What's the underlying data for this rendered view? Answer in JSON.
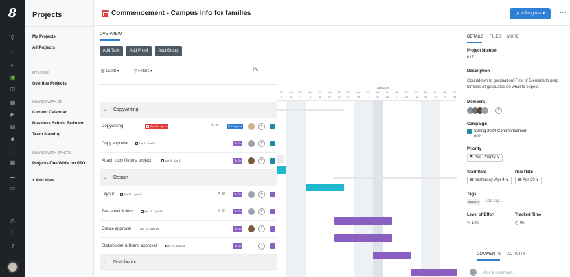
{
  "rail": {
    "logo": "8",
    "icons": [
      "search-icon",
      "home-icon",
      "megaphone-icon",
      "projects-icon",
      "approvals-icon",
      "print-icon",
      "tasks-icon",
      "calendar-icon",
      "people-icon",
      "user-icon",
      "grid-icon",
      "reports-icon",
      "file-icon",
      "clock-icon",
      "bell-icon",
      "help-icon"
    ]
  },
  "nav": {
    "title": "Projects",
    "my_projects": "My Projects",
    "all_projects": "All Projects",
    "my_views_label": "MY VIEWS",
    "overdue": "Overdue Projects",
    "shared_with_me_label": "SHARED WITH ME",
    "shared_with_me": [
      "Content Calendar",
      "Business School Re-brand",
      "Team Standup"
    ],
    "shared_with_others_label": "SHARED WITH OTHERS",
    "shared_with_others": [
      "Projects Due While on PTO"
    ],
    "add_view": "+ Add View"
  },
  "header": {
    "title": "Commencement - Campus Info for families",
    "status": "◷ In Progress ▾",
    "menu": "···"
  },
  "main": {
    "tab": "OVERVIEW",
    "buttons": [
      "Add Task",
      "Add Proof",
      "Add Group"
    ],
    "view_select": "Gantt ▾",
    "filters": "▽ Filters ▾"
  },
  "groups": [
    {
      "chev": "⌄",
      "name": "Copywriting"
    },
    {
      "chev": "⌄",
      "name": "Design"
    },
    {
      "chev": "⌄",
      "name": "Distribution"
    }
  ],
  "tasks": [
    {
      "name": "Copywriting",
      "date": "Mar 11 - Apr 4",
      "effort": "3h",
      "status": "In Progress"
    },
    {
      "name": "Copy approval",
      "date": "Apr 5 - Apr 5",
      "effort": "",
      "status": "To Do"
    },
    {
      "name": "Attach copy file to a project",
      "date": "Apr 8 - Apr 11",
      "effort": "",
      "status": "To Do"
    },
    {
      "name": "Layout",
      "date": "Apr 11 - Apr 18",
      "effort": "5h",
      "status": "To Do"
    },
    {
      "name": "Test email & links",
      "date": "Apr 11 - Apr 18",
      "effort": "1h",
      "status": "To Do"
    },
    {
      "name": "Create approval",
      "date": "Apr 15 - Apr 19",
      "effort": "",
      "status": "To Do"
    },
    {
      "name": "Stakeholder & Brand approval",
      "date": "Apr 19 - Apr 23",
      "effort": "",
      "status": "To Do"
    }
  ],
  "gantt": {
    "month": "April 2024",
    "days": [
      {
        "l": "Fr",
        "n": "5"
      },
      {
        "l": "Sa",
        "n": "6"
      },
      {
        "l": "Su",
        "n": "7"
      },
      {
        "l": "Mo",
        "n": "8"
      },
      {
        "l": "Tu",
        "n": "9"
      },
      {
        "l": "We",
        "n": "10"
      },
      {
        "l": "Th",
        "n": "11"
      },
      {
        "l": "Fr",
        "n": "12"
      },
      {
        "l": "Sa",
        "n": "13"
      },
      {
        "l": "Su",
        "n": "14"
      },
      {
        "l": "Mo",
        "n": "15"
      },
      {
        "l": "Tu",
        "n": "16"
      },
      {
        "l": "We",
        "n": "17"
      },
      {
        "l": "Th",
        "n": "18"
      },
      {
        "l": "Fr",
        "n": "19"
      },
      {
        "l": "Sa",
        "n": "20"
      },
      {
        "l": "Su",
        "n": "21"
      },
      {
        "l": "Mo",
        "n": "22"
      },
      {
        "l": "Tu",
        "n": "23"
      }
    ]
  },
  "panel": {
    "tabs": [
      "DETAILS",
      "FILES",
      "MORE"
    ],
    "project_number_label": "Project Number",
    "project_number": "017",
    "description_label": "Description",
    "description": "Countdown to graduation! First of 5 emails to prep families of graduates on what to expect.",
    "members_label": "Members",
    "campaign_label": "Campaign",
    "campaign": "Spring 2024 Commencement",
    "campaign_id": "002",
    "priority_label": "Priority",
    "priority": "⚑ Add Priority ∨",
    "start_label": "Start Date",
    "start": "▦ Yesterday, Apr 4 ∨",
    "due_label": "Due Date",
    "due": "▦ Apr 30 ∨",
    "tags_label": "Tags",
    "tag": "EMAIL ×",
    "add_tag": "Add tag...",
    "effort_label": "Level of Effort",
    "effort": "✎ 14h",
    "tracked_label": "Tracked Time",
    "tracked": "◷ 0h",
    "comments_tabs": [
      "COMMENTS",
      "ACTIVITY"
    ],
    "add_comment": "Add a comment..."
  },
  "colors": {
    "accent": "#2f7fd6",
    "todo": "#8a5fc2",
    "teal": "#1eb8cf",
    "red": "#e23b3b",
    "rail": "#1f2226"
  }
}
